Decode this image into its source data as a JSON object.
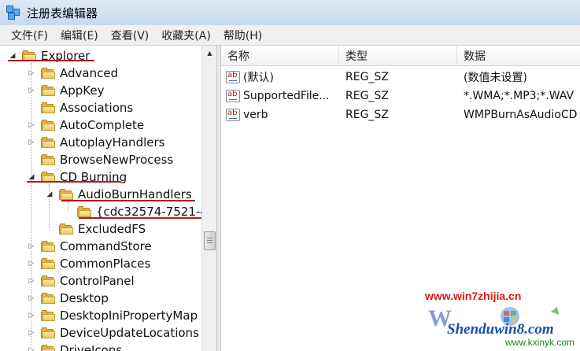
{
  "window": {
    "title": "注册表编辑器",
    "icon": "registry-editor-icon"
  },
  "menu": [
    "文件(F)",
    "编辑(E)",
    "查看(V)",
    "收藏夹(A)",
    "帮助(H)"
  ],
  "tree": {
    "root": "Explorer",
    "items": [
      "Advanced",
      "AppKey",
      "Associations",
      "AutoComplete",
      "AutoplayHandlers",
      "BrowseNewProcess",
      "CD Burning",
      "AudioBurnHandlers",
      "{cdc32574-7521-4",
      "ExcludedFS",
      "CommandStore",
      "CommonPlaces",
      "ControlPanel",
      "Desktop",
      "DesktopIniPropertyMap",
      "DeviceUpdateLocations",
      "DriveIcons"
    ]
  },
  "list": {
    "columns": [
      "名称",
      "类型",
      "数据"
    ],
    "rows": [
      {
        "name": "(默认)",
        "type": "REG_SZ",
        "data": "(数值未设置)"
      },
      {
        "name": "SupportedFile...",
        "type": "REG_SZ",
        "data": "*.WMA;*.MP3;*.WAV"
      },
      {
        "name": "verb",
        "type": "REG_SZ",
        "data": "WMPBurnAsAudioCD"
      }
    ]
  },
  "watermark": {
    "url": "www.win7zhijia.cn",
    "brand": "Shenduwin8.com",
    "domain": "www.kxinyk.com"
  },
  "colors": {
    "highlight_underline": "#b51a1a",
    "folder": "#f1c85b"
  }
}
